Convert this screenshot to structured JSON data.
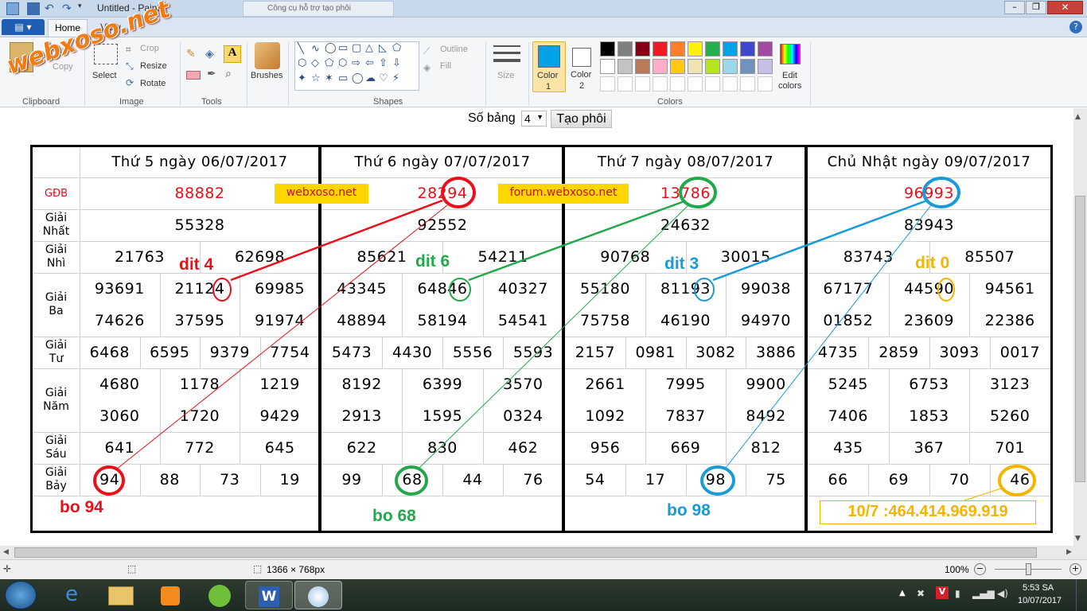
{
  "window": {
    "title": "Untitled - Paint",
    "browser_tab": "Công cụ hỗ trợ tạo phôi"
  },
  "ribbon": {
    "tabs": {
      "file": "",
      "home": "Home",
      "view": "View"
    },
    "clipboard": {
      "paste": "Paste",
      "cut": "Cut",
      "copy": "Copy",
      "group": "Clipboard"
    },
    "image": {
      "select": "Select",
      "crop": "Crop",
      "resize": "Resize",
      "rotate": "Rotate",
      "group": "Image"
    },
    "tools": {
      "group": "Tools"
    },
    "brushes": {
      "label": "Brushes"
    },
    "shapes": {
      "outline": "Outline",
      "fill": "Fill",
      "group": "Shapes"
    },
    "size": {
      "label": "Size"
    },
    "colors": {
      "color1": "Color",
      "color1_num": "1",
      "color2": "Color",
      "color2_num": "2",
      "edit": "Edit",
      "edit2": "colors",
      "group": "Colors",
      "palette": [
        "#000000",
        "#7f7f7f",
        "#880015",
        "#ed1c24",
        "#ff7f27",
        "#fff200",
        "#22b14c",
        "#00a2e8",
        "#3f48cc",
        "#a349a4",
        "#ffffff",
        "#c3c3c3",
        "#b97a57",
        "#ffaec9",
        "#ffc90e",
        "#efe4b0",
        "#b5e61d",
        "#99d9ea",
        "#7092be",
        "#c8bfe7"
      ],
      "color1_value": "#00a2e8",
      "color2_value": "#ffffff"
    }
  },
  "form": {
    "label": "Số bảng",
    "select_value": "4",
    "button": "Tạo phôi"
  },
  "watermark": "webxoso.net",
  "sheet": {
    "row_labels": {
      "gdb": "GĐB",
      "nhat_1": "Giải",
      "nhat_2": "Nhất",
      "nhi_1": "Giải",
      "nhi_2": "Nhì",
      "ba_1": "Giải",
      "ba_2": "Ba",
      "tu_1": "Giải",
      "tu_2": "Tư",
      "nam_1": "Giải",
      "nam_2": "Năm",
      "sau_1": "Giải",
      "sau_2": "Sáu",
      "bay_1": "Giải",
      "bay_2": "Bảy"
    },
    "banner1": "webxoso.net",
    "banner2": "forum.webxoso.net",
    "days": [
      {
        "header": "Thứ 5 ngày 06/07/2017",
        "gdb": "88882",
        "nhat": "55328",
        "nhi": [
          "21763",
          "62698"
        ],
        "ba": [
          "93691",
          "21124",
          "69985",
          "74626",
          "37595",
          "91974"
        ],
        "tu": [
          "6468",
          "6595",
          "9379",
          "7754"
        ],
        "nam": [
          "4680",
          "1178",
          "1219",
          "3060",
          "1720",
          "9429"
        ],
        "sau": [
          "641",
          "772",
          "645"
        ],
        "bay": [
          "94",
          "88",
          "73",
          "19"
        ]
      },
      {
        "header": "Thứ 6 ngày 07/07/2017",
        "gdb": "28294",
        "nhat": "92552",
        "nhi": [
          "85621",
          "54211"
        ],
        "ba": [
          "43345",
          "64846",
          "40327",
          "48894",
          "58194",
          "54541"
        ],
        "tu": [
          "5473",
          "4430",
          "5556",
          "5593"
        ],
        "nam": [
          "8192",
          "6399",
          "3570",
          "2913",
          "1595",
          "0324"
        ],
        "sau": [
          "622",
          "830",
          "462"
        ],
        "bay": [
          "99",
          "68",
          "44",
          "76"
        ]
      },
      {
        "header": "Thứ 7 ngày 08/07/2017",
        "gdb": "13786",
        "nhat": "24632",
        "nhi": [
          "90768",
          "30015"
        ],
        "ba": [
          "55180",
          "81193",
          "99038",
          "75758",
          "46190",
          "94970"
        ],
        "tu": [
          "2157",
          "0981",
          "3082",
          "3886"
        ],
        "nam": [
          "2661",
          "7995",
          "9900",
          "1092",
          "7837",
          "8492"
        ],
        "sau": [
          "956",
          "669",
          "812"
        ],
        "bay": [
          "54",
          "17",
          "98",
          "75"
        ]
      },
      {
        "header": "Chủ Nhật ngày 09/07/2017",
        "gdb": "96993",
        "nhat": "83943",
        "nhi": [
          "83743",
          "85507"
        ],
        "ba": [
          "67177",
          "44590",
          "94561",
          "01852",
          "23609",
          "22386"
        ],
        "tu": [
          "4735",
          "2859",
          "3093",
          "0017"
        ],
        "nam": [
          "5245",
          "6753",
          "3123",
          "7406",
          "1853",
          "5260"
        ],
        "sau": [
          "435",
          "367",
          "701"
        ],
        "bay": [
          "66",
          "69",
          "70",
          "46"
        ]
      }
    ],
    "notes": {
      "dit1": "dit 4",
      "dit2": "dit 6",
      "dit3": "dit 3",
      "dit4": "dit 0",
      "bo1": "bo 94",
      "bo2": "bo 68",
      "bo3": "bo 98",
      "result": "10/7 :464.414.969.919"
    },
    "note_colors": {
      "red": "#e8101a",
      "green": "#21a84a",
      "blue": "#1a9ad6",
      "orange": "#f5b400"
    }
  },
  "statusbar": {
    "dimensions": "1366 × 768px",
    "zoom": "100%"
  },
  "taskbar": {
    "time": "5:53 SA",
    "date": "10/07/2017"
  }
}
